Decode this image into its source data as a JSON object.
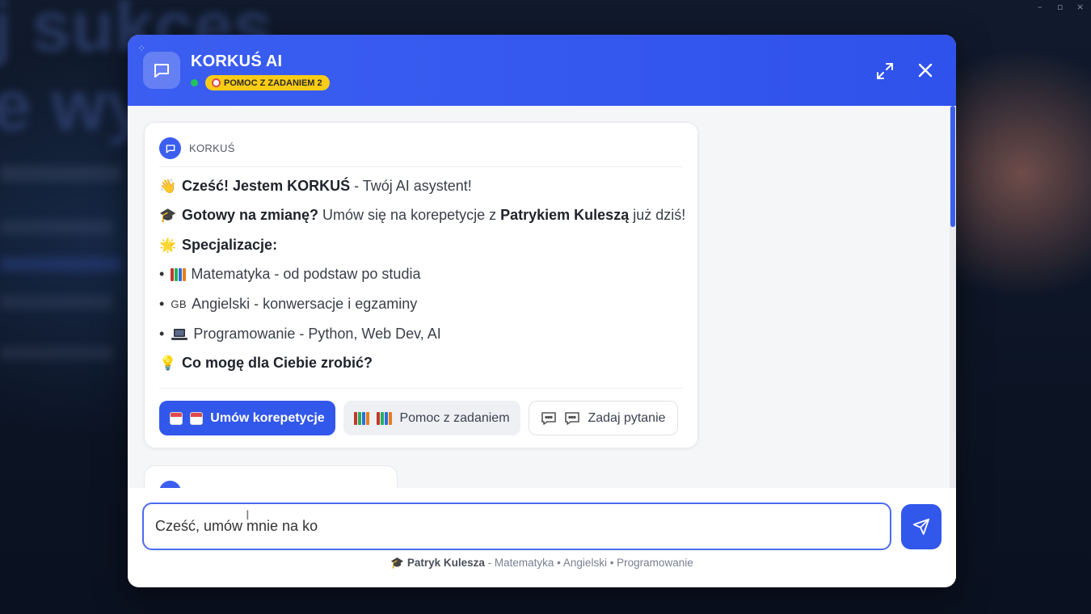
{
  "background": {
    "big_text_1": "j sukces",
    "big_text_2": "e wy",
    "window_controls": [
      "–",
      "▫",
      "×"
    ]
  },
  "header": {
    "title": "KORKUŚ AI",
    "badge": "POMOC Z ZADANIEM 2",
    "status_color": "#22c55e",
    "accent": "#3b5ef1"
  },
  "message": {
    "sender": "KORKUŚ",
    "line1": {
      "emoji": "👋",
      "bold": "Cześć! Jestem KORKUŚ",
      "rest": " - Twój AI asystent!"
    },
    "line2": {
      "emoji": "🎓",
      "bold": "Gotowy na zmianę?",
      "rest": " Umów się na korepetycje z ",
      "bold2": "Patrykiem Kuleszą",
      "rest2": " już dziś!"
    },
    "line3": {
      "emoji": "🌟",
      "bold": "Specjalizacje:"
    },
    "specializations": [
      {
        "bullet": "•",
        "icon": "books",
        "text": "Matematyka - od podstaw po studia"
      },
      {
        "bullet": "•",
        "icon": "GB",
        "text": "Angielski - konwersacje i egzaminy"
      },
      {
        "bullet": "•",
        "icon": "laptop",
        "text": "Programowanie - Python, Web Dev, AI"
      }
    ],
    "line_last": {
      "emoji": "💡",
      "bold": "Co mogę dla Ciebie zrobić?"
    }
  },
  "actions": {
    "book": "Umów korepetycje",
    "help": "Pomoc z zadaniem",
    "ask": "Zadaj pytanie"
  },
  "input": {
    "value": "Cześć, umów mnie na ko"
  },
  "footer": {
    "emoji": "🎓",
    "name": "Patryk Kulesza",
    "subjects": " - Matematyka • Angielski • Programowanie"
  }
}
